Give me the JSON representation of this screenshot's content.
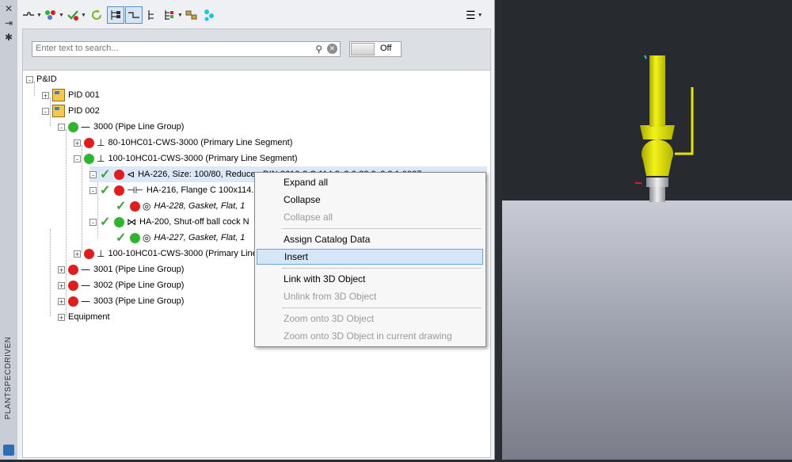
{
  "strip": {
    "close_icon": "close-icon",
    "pin_icon": "autohide-icon",
    "props_icon": "properties-icon",
    "title": "PLANTSPECDRIVEN"
  },
  "toolbar": {
    "tools": [
      {
        "name": "line-style-icon",
        "dropdown": true
      },
      {
        "name": "color-filter-icon",
        "dropdown": true
      },
      {
        "name": "validation-icon",
        "dropdown": true
      },
      {
        "name": "refresh-icon",
        "dropdown": false
      },
      {
        "name": "tree-view-icon",
        "dropdown": false,
        "pressed": true
      },
      {
        "name": "line-view-icon",
        "dropdown": false,
        "pressed": true
      },
      {
        "name": "hierarchy-icon",
        "dropdown": false
      },
      {
        "name": "sort-icon",
        "dropdown": true
      },
      {
        "name": "link-icon",
        "dropdown": false
      },
      {
        "name": "connect-icon",
        "dropdown": false
      }
    ],
    "menu_icon": "hamburger-menu-icon"
  },
  "search": {
    "placeholder": "Enter text to search...",
    "value": "",
    "toggle_label": "Off"
  },
  "tree": {
    "rows": [
      {
        "label": "P&ID",
        "expander": "-"
      },
      {
        "label": "PID 001",
        "expander": "+"
      },
      {
        "label": "PID 002",
        "expander": "-"
      },
      {
        "label": "3000 (Pipe Line Group)",
        "expander": "-"
      },
      {
        "label": "80-10HC01-CWS-3000 (Primary Line Segment)",
        "expander": "+"
      },
      {
        "label": "100-10HC01-CWS-3000 (Primary Line Segment)",
        "expander": "-"
      },
      {
        "label": "HA-226, Size: 100/80, Reducer, DIN 2616-2 C 114.3x3.6-88.9x3.2 1.0037",
        "expander": "-"
      },
      {
        "label": "HA-216, Flange C 100x114.3",
        "expander": "-"
      },
      {
        "label": "HA-228, Gasket, Flat, 1",
        "expander": ""
      },
      {
        "label": "HA-200, Shut-off ball cock N",
        "expander": "-"
      },
      {
        "label": "HA-227, Gasket, Flat, 1",
        "expander": ""
      },
      {
        "label": "100-10HC01-CWS-3000 (Primary Line",
        "expander": "+"
      },
      {
        "label": "3001 (Pipe Line Group)",
        "expander": "+"
      },
      {
        "label": "3002 (Pipe Line Group)",
        "expander": "+"
      },
      {
        "label": "3003 (Pipe Line Group)",
        "expander": "+"
      },
      {
        "label": "Equipment",
        "expander": "+"
      }
    ]
  },
  "context_menu": {
    "items": [
      {
        "label": "Expand all",
        "enabled": true
      },
      {
        "label": "Collapse",
        "enabled": true
      },
      {
        "label": "Collapse all",
        "enabled": false
      },
      {
        "label": "Assign Catalog Data",
        "enabled": true
      },
      {
        "label": "Insert",
        "enabled": true,
        "highlighted": true
      },
      {
        "label": "Link with 3D Object",
        "enabled": true
      },
      {
        "label": "Unlink from 3D Object",
        "enabled": false
      },
      {
        "label": "Zoom onto 3D Object",
        "enabled": false
      },
      {
        "label": "Zoom onto 3D Object in current drawing",
        "enabled": false
      }
    ]
  },
  "colors": {
    "status_red": "#e21b1b",
    "status_green": "#2db52d",
    "check_green": "#3ca13c",
    "valve_yellow": "#e6e600",
    "selection": "#d5e6f8"
  }
}
